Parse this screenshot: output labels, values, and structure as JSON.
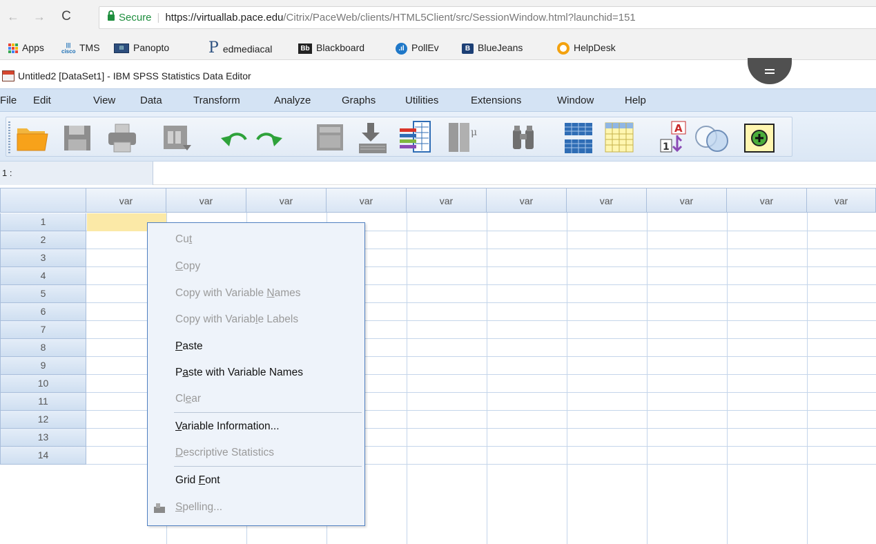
{
  "browser": {
    "secure_label": "Secure",
    "url_host": "https://virtuallab.pace.edu",
    "url_path": "/Citrix/PaceWeb/clients/HTML5Client/src/SessionWindow.html?launchid=151",
    "bookmarks": [
      "Apps",
      "TMS",
      "Panopto",
      "edmediacal",
      "Blackboard",
      "PollEv",
      "BlueJeans",
      "HelpDesk"
    ],
    "bookmark_icons": [
      "apps-grid-icon",
      "cisco-icon",
      "panopto-icon",
      "p-logo-icon",
      "blackboard-icon",
      "pollev-icon",
      "bluejeans-icon",
      "helpdesk-icon"
    ]
  },
  "window": {
    "title": "Untitled2 [DataSet1] - IBM SPSS Statistics Data Editor"
  },
  "menu": [
    "File",
    "Edit",
    "View",
    "Data",
    "Transform",
    "Analyze",
    "Graphs",
    "Utilities",
    "Extensions",
    "Window",
    "Help"
  ],
  "toolbar_icons": [
    "open-folder-icon",
    "save-icon",
    "print-icon",
    "dialog-recall-icon",
    "undo-icon",
    "redo-icon",
    "go-to-case-icon",
    "go-to-variable-icon",
    "variables-icon",
    "run-descriptives-icon",
    "find-icon",
    "insert-cases-icon",
    "insert-variable-icon",
    "split-file-icon",
    "value-labels-icon",
    "use-variable-sets-icon"
  ],
  "cell_ref": "1 :",
  "grid": {
    "column_header": "var",
    "column_count": 10,
    "rows": [
      "1",
      "2",
      "3",
      "4",
      "5",
      "6",
      "7",
      "8",
      "9",
      "10",
      "11",
      "12",
      "13",
      "14"
    ]
  },
  "context_menu": {
    "items": [
      {
        "pre": "Cu",
        "key": "t",
        "post": "",
        "enabled": false
      },
      {
        "pre": "",
        "key": "C",
        "post": "opy",
        "enabled": false
      },
      {
        "pre": "Copy with Variable ",
        "key": "N",
        "post": "ames",
        "enabled": false
      },
      {
        "pre": "Copy with Variab",
        "key": "l",
        "post": "e Labels",
        "enabled": false
      },
      {
        "pre": "",
        "key": "P",
        "post": "aste",
        "enabled": true
      },
      {
        "pre": "P",
        "key": "a",
        "post": "ste with Variable Names",
        "enabled": true
      },
      {
        "pre": "Cl",
        "key": "e",
        "post": "ar",
        "enabled": false
      },
      {
        "pre": "",
        "key": "V",
        "post": "ariable Information...",
        "enabled": true
      },
      {
        "pre": "",
        "key": "D",
        "post": "escriptive Statistics",
        "enabled": false
      },
      {
        "pre": "Grid ",
        "key": "F",
        "post": "ont",
        "enabled": true
      },
      {
        "pre": "",
        "key": "S",
        "post": "pelling...",
        "enabled": false
      }
    ]
  },
  "colors": {
    "menubar_bg": "#d4e3f4",
    "grid_line": "#c4d5ea",
    "active_cell": "#fbe9a7",
    "context_border": "#4f7fc0",
    "secure_green": "#1e8e3e"
  }
}
